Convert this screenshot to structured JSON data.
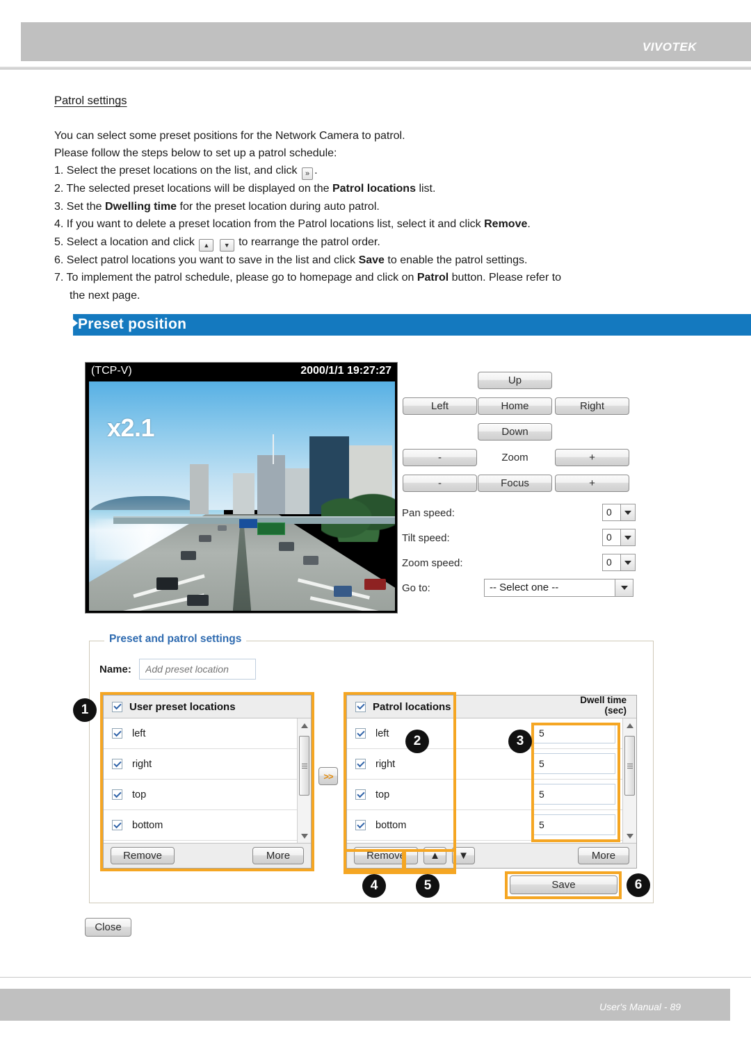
{
  "header": {
    "brand": "VIVOTEK"
  },
  "footer": {
    "text": "User's Manual - 89"
  },
  "doc": {
    "section_title": "Patrol settings",
    "intro_line1": "You can select some preset positions for the Network Camera to patrol.",
    "intro_line2": "Please follow the steps below to set up a patrol schedule:",
    "steps": [
      {
        "num": "1.",
        "pre": "Select the preset locations on the list, and click",
        "icon": "»",
        "post": "."
      },
      {
        "num": "2.",
        "pre": "The selected preset locations will be displayed on the",
        "bold": "Patrol locations",
        "post": "list."
      },
      {
        "num": "3.",
        "pre": "Set the",
        "bold": "Dwelling time",
        "post": "for the preset location during auto patrol."
      },
      {
        "num": "4.",
        "pre": "If you want to delete a preset location from the Patrol locations list, select it and click",
        "bold": "Remove",
        "post": "."
      },
      {
        "num": "5.",
        "pre": "Select a location and click",
        "icon_up": "▲",
        "icon_down": "▼",
        "post": "to rearrange the patrol order."
      },
      {
        "num": "6.",
        "pre": "Select patrol locations you want to save in the list and click",
        "bold": "Save",
        "post": "to enable the patrol settings."
      },
      {
        "num": "7.",
        "pre": "To implement the patrol schedule, please go to homepage and click on",
        "bold": "Patrol",
        "post": "button. Please refer to",
        "cont": "the next page."
      }
    ]
  },
  "panel": {
    "title": "Preset position"
  },
  "video": {
    "osd_left": "(TCP-V)",
    "osd_right": "2000/1/1 19:27:27",
    "zoom_label": "x2.1"
  },
  "ptz": {
    "up": "Up",
    "left": "Left",
    "home": "Home",
    "right": "Right",
    "down": "Down",
    "zoom_minus": "-",
    "zoom_label": "Zoom",
    "zoom_plus": "+",
    "focus_minus": "-",
    "focus_label": "Focus",
    "focus_plus": "+"
  },
  "speeds": [
    {
      "label": "Pan speed:",
      "value": "0"
    },
    {
      "label": "Tilt speed:",
      "value": "0"
    },
    {
      "label": "Zoom speed:",
      "value": "0"
    }
  ],
  "goto": {
    "label": "Go to:",
    "value": "-- Select one --"
  },
  "settings": {
    "legend": "Preset and patrol settings",
    "name_label": "Name:",
    "name_placeholder": "Add preset location",
    "name_value": ""
  },
  "user_presets": {
    "header": "User preset locations",
    "items": [
      {
        "label": "left",
        "checked": true
      },
      {
        "label": "right",
        "checked": true
      },
      {
        "label": "top",
        "checked": true
      },
      {
        "label": "bottom",
        "checked": true
      }
    ],
    "remove_label": "Remove",
    "more_label": "More"
  },
  "patrol": {
    "header": "Patrol locations",
    "dwell_header_line1": "Dwell time",
    "dwell_header_line2": "(sec)",
    "items": [
      {
        "label": "left",
        "checked": true,
        "dwell": "5"
      },
      {
        "label": "right",
        "checked": true,
        "dwell": "5"
      },
      {
        "label": "top",
        "checked": true,
        "dwell": "5"
      },
      {
        "label": "bottom",
        "checked": true,
        "dwell": "5"
      }
    ],
    "remove_label": "Remove",
    "up_label": "▲",
    "down_label": "▼",
    "more_label": "More"
  },
  "transfer_button": {
    "label": ">>"
  },
  "actions": {
    "save_label": "Save",
    "close_label": "Close"
  },
  "callouts": [
    {
      "n": "1"
    },
    {
      "n": "2"
    },
    {
      "n": "3"
    },
    {
      "n": "4"
    },
    {
      "n": "5"
    },
    {
      "n": "6"
    }
  ],
  "colors": {
    "brand_blue": "#1479bf",
    "legend_blue": "#2f6bb0",
    "highlight_orange": "#f5a623",
    "header_gray": "#c0c0c0"
  }
}
